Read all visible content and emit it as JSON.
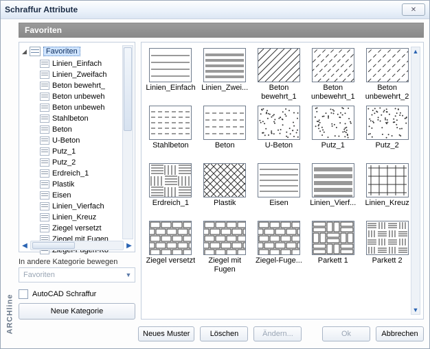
{
  "window": {
    "title": "Schraffur Attribute",
    "close_glyph": "✕"
  },
  "favorites_header": "Favoriten",
  "brand": "ARCHline",
  "tree": {
    "root_label": "Favoriten",
    "items": [
      "Linien_Einfach",
      "Linien_Zweifach",
      "Beton bewehrt_",
      "Beton unbeweh",
      "Beton unbeweh",
      "Stahlbeton",
      "Beton",
      "U-Beton",
      "Putz_1",
      "Putz_2",
      "Erdreich_1",
      "Plastik",
      "Eisen",
      "Linien_Vierfach",
      "Linien_Kreuz",
      "Ziegel versetzt",
      "Ziegel mit Fugen",
      "Ziegel-Fugen-Ko"
    ]
  },
  "left": {
    "move_label": "In andere Kategorie bewegen",
    "combo_value": "Favoriten",
    "checkbox_label": "AutoCAD Schraffur",
    "new_category": "Neue Kategorie"
  },
  "swatches": [
    {
      "label": "Linien_Einfach",
      "pattern": "hlines"
    },
    {
      "label": "Linien_Zwei...",
      "pattern": "hlines2"
    },
    {
      "label": "Beton bewehrt_1",
      "pattern": "diag"
    },
    {
      "label": "Beton unbewehrt_1",
      "pattern": "diagdash"
    },
    {
      "label": "Beton unbewehrt_2",
      "pattern": "diagdash2"
    },
    {
      "label": "Stahlbeton",
      "pattern": "dashrows"
    },
    {
      "label": "Beton",
      "pattern": "dashthin"
    },
    {
      "label": "U-Beton",
      "pattern": "speckle"
    },
    {
      "label": "Putz_1",
      "pattern": "speckle"
    },
    {
      "label": "Putz_2",
      "pattern": "speckle"
    },
    {
      "label": "Erdreich_1",
      "pattern": "weave"
    },
    {
      "label": "Plastik",
      "pattern": "cross"
    },
    {
      "label": "Eisen",
      "pattern": "hlines3"
    },
    {
      "label": "Linien_Vierf...",
      "pattern": "hlines4"
    },
    {
      "label": "Linien_Kreuz",
      "pattern": "gridplus"
    },
    {
      "label": "Ziegel versetzt",
      "pattern": "brick"
    },
    {
      "label": "Ziegel mit Fugen",
      "pattern": "brick2"
    },
    {
      "label": "Ziegel-Fuge...",
      "pattern": "brick3"
    },
    {
      "label": "Parkett 1",
      "pattern": "parquet1"
    },
    {
      "label": "Parkett 2",
      "pattern": "parquet2"
    }
  ],
  "buttons": {
    "new_pattern": "Neues Muster",
    "delete": "Löschen",
    "modify": "Ändern...",
    "ok": "Ok",
    "cancel": "Abbrechen"
  }
}
